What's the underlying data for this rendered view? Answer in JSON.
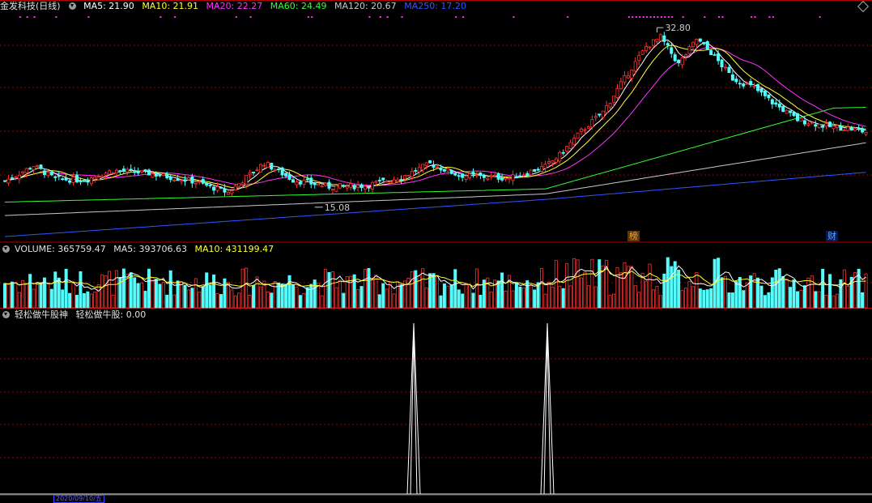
{
  "price": {
    "stock_name": "金发科技",
    "period": "(日线)",
    "ma": [
      {
        "label": "MA5: 21.90",
        "color": "#ffffff"
      },
      {
        "label": "MA10: 21.91",
        "color": "#ffff33"
      },
      {
        "label": "MA20: 22.27",
        "color": "#ff33ff"
      },
      {
        "label": "MA60: 24.49",
        "color": "#33ff33"
      },
      {
        "label": "MA120: 20.67",
        "color": "#c8c8c8"
      },
      {
        "label": "MA250: 17.20",
        "color": "#3355ff"
      }
    ],
    "high_label": "32.80",
    "low_label": "15.08",
    "colors": {
      "up": "#ff3232",
      "down": "#54fcfc",
      "grid": "#a00000",
      "ma5": "#ffffff",
      "ma10": "#ffff33",
      "ma20": "#ff33ff",
      "ma60": "#33ff33",
      "ma120": "#c8c8c8",
      "ma250": "#3355ff"
    }
  },
  "markers": {
    "bang": "榜",
    "cai": "财"
  },
  "volume": {
    "title": "VOLUME: 365759.47",
    "ma5": "MA5: 393706.63",
    "ma10": "MA10: 431199.47"
  },
  "indicator": {
    "name": "轻松做牛股神",
    "value_label": "轻松做牛股: 0.00"
  },
  "dates": {
    "selected": "2020/09/10/五"
  }
}
